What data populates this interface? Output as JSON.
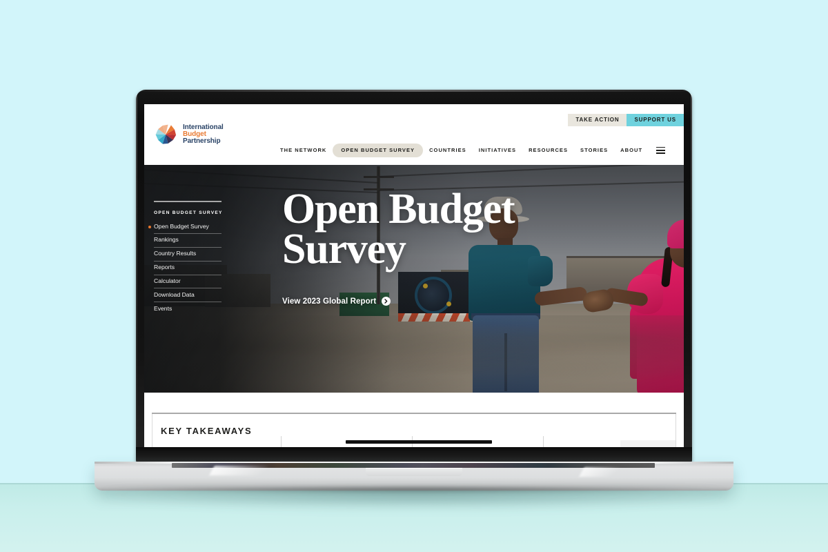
{
  "page": {
    "background_color": "#d2f5fa",
    "surface_color": "#c6efeb"
  },
  "brand": {
    "logo_icon": "pinwheel-logo-icon",
    "line1": "International",
    "line2": "Budget",
    "line3": "Partnership",
    "color_navy": "#1f3a5f",
    "color_orange": "#e8762c"
  },
  "utility_bar": {
    "take_action_label": "TAKE ACTION",
    "take_action_bg": "#e9e6de",
    "support_us_label": "SUPPORT US",
    "support_us_bg": "#6fd2de"
  },
  "mainnav": {
    "items": [
      {
        "label": "THE NETWORK",
        "active": false
      },
      {
        "label": "OPEN BUDGET SURVEY",
        "active": true
      },
      {
        "label": "COUNTRIES",
        "active": false
      },
      {
        "label": "INITIATIVES",
        "active": false
      },
      {
        "label": "RESOURCES",
        "active": false
      },
      {
        "label": "STORIES",
        "active": false
      },
      {
        "label": "ABOUT",
        "active": false
      }
    ],
    "menu_icon": "hamburger-menu-icon",
    "active_pill_color": "#e3dfd5"
  },
  "hero": {
    "sidebar": {
      "title": "OPEN BUDGET SURVEY",
      "active_marker_color": "#e8762c",
      "items": [
        {
          "label": "Open Budget Survey",
          "active": true
        },
        {
          "label": "Rankings",
          "active": false
        },
        {
          "label": "Country Results",
          "active": false
        },
        {
          "label": "Reports",
          "active": false
        },
        {
          "label": "Calculator",
          "active": false
        },
        {
          "label": "Download Data",
          "active": false
        },
        {
          "label": "Events",
          "active": false
        }
      ]
    },
    "title_line1": "Open Budget",
    "title_line2": "Survey",
    "cta_label": "View 2023 Global Report",
    "cta_icon": "arrow-right-circle-icon",
    "photo_alt": "Two people shaking hands on a sandy street in an informal settlement under an overcast sky"
  },
  "takeaways": {
    "heading": "KEY TAKEAWAYS"
  }
}
